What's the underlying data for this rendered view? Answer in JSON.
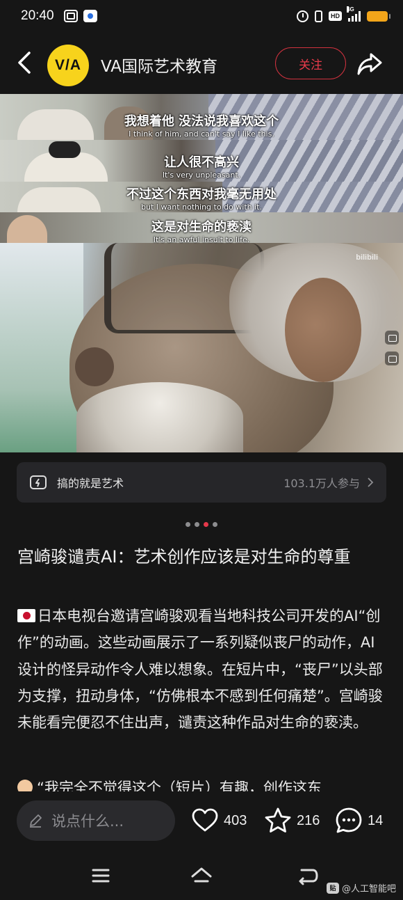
{
  "status_bar": {
    "time": "20:40",
    "network": "4G"
  },
  "header": {
    "avatar_text": "V/A",
    "account_name": "VA国际艺术教育",
    "follow_label": "关注"
  },
  "video": {
    "subtitles": [
      {
        "cn": "我想着他 没法说我喜欢这个",
        "en": "I think of him, and can't say I like this."
      },
      {
        "cn": "让人很不高兴",
        "en": "It's very unpleasant."
      },
      {
        "cn": "不过这个东西对我毫无用处",
        "en": "but I want nothing to do with it."
      },
      {
        "cn": "这是对生命的亵渎",
        "en": "It's an awful insult to life."
      }
    ],
    "watermark": "bilibili"
  },
  "topic": {
    "label": "搞的就是艺术",
    "count": "103.1万人参与"
  },
  "carousel": {
    "total": 4,
    "active_index": 2
  },
  "article": {
    "title": "宫崎骏谴责AI：艺术创作应该是对生命的尊重",
    "body": "日本电视台邀请宫崎骏观看当地科技公司开发的AI“创作”的动画。这些动画展示了一系列疑似丧尸的动作，AI设计的怪异动作令人难以想象。在短片中，“丧尸”以头部为支撑，扭动身体，“仿佛根本不感到任何痛楚”。宫崎骏未能看完便忍不住出声，谴责这种作品对生命的亵渎。",
    "next_line": "“我完全不觉得这个（短片）有趣，创作这东"
  },
  "actions": {
    "comment_placeholder": "说点什么...",
    "likes": "403",
    "favorites": "216",
    "comments": "14"
  },
  "footer": {
    "watermark": "@人工智能吧",
    "watermark_logo": "贴"
  },
  "colors": {
    "background": "#161616",
    "accent_red": "#e5384a",
    "avatar_yellow": "#f7d31c"
  }
}
